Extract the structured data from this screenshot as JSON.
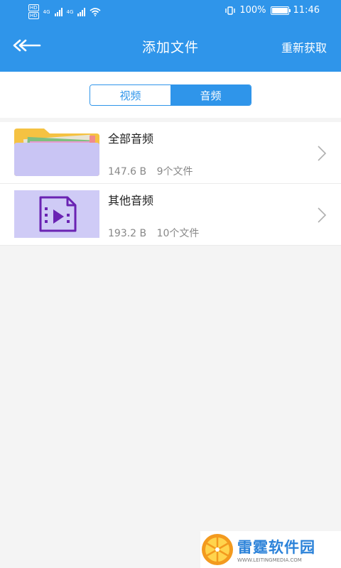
{
  "status_bar": {
    "left_badges": [
      "HD",
      "HD"
    ],
    "network_labels": [
      "4G",
      "4G"
    ],
    "battery_percent": "100%",
    "time": "11:46"
  },
  "header": {
    "title": "添加文件",
    "refresh_label": "重新获取",
    "background_color": "#2f95ea"
  },
  "tabs": [
    {
      "label": "视频",
      "active": false
    },
    {
      "label": "音频",
      "active": true
    }
  ],
  "list": [
    {
      "title": "全部音频",
      "size": "147.6 B",
      "count": "9个文件",
      "icon": "folder-icon"
    },
    {
      "title": "其他音频",
      "size": "193.2 B",
      "count": "10个文件",
      "icon": "video-file-icon"
    }
  ],
  "watermark": {
    "main": "雷霆软件园",
    "sub": "WWW.LEITINGMEDIA.COM"
  }
}
